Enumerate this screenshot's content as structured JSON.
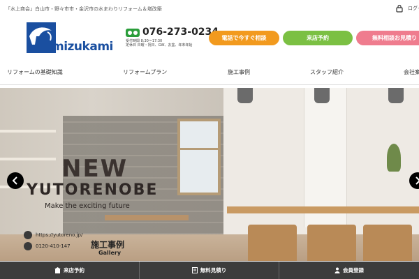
{
  "header": {
    "tagline": "「水上商会」白山市・野々市市・金沢市の水まわりリフォーム＆増改築",
    "login_label": "ログイン"
  },
  "brand": {
    "logo_text": "mizukami",
    "logo_color": "#1a4fa0"
  },
  "contact": {
    "phone": "076-273-0234",
    "hours_line1": "受付時間 8:30～17:30",
    "hours_line2": "定休日 日曜・祝日、GW、お盆、年末年始"
  },
  "cta_buttons": [
    {
      "label": "電話で今すぐ相談",
      "color": "#f29a1e"
    },
    {
      "label": "来店予約",
      "color": "#7bc043"
    },
    {
      "label": "無料相談お見積り",
      "color": "#ef7c8e"
    }
  ],
  "nav": {
    "items": [
      {
        "label": "リフォームの基礎知識"
      },
      {
        "label": "リフォームプラン"
      },
      {
        "label": "施工事例"
      },
      {
        "label": "スタッフ紹介"
      },
      {
        "label": "会社案内"
      }
    ]
  },
  "hero": {
    "headline_1": "NEW",
    "headline_2": "YUTORENOBE",
    "subline": "Make the exciting future",
    "website": "https://yutoreno.jp/",
    "phone": "0120-410-147",
    "works_label": "施工事例",
    "gallery_label": "Gallery"
  },
  "footer_bar": {
    "items": [
      {
        "label": "来店予約",
        "icon": "store-icon"
      },
      {
        "label": "無料見積り",
        "icon": "estimate-icon"
      },
      {
        "label": "会員登録",
        "icon": "member-icon"
      }
    ]
  }
}
